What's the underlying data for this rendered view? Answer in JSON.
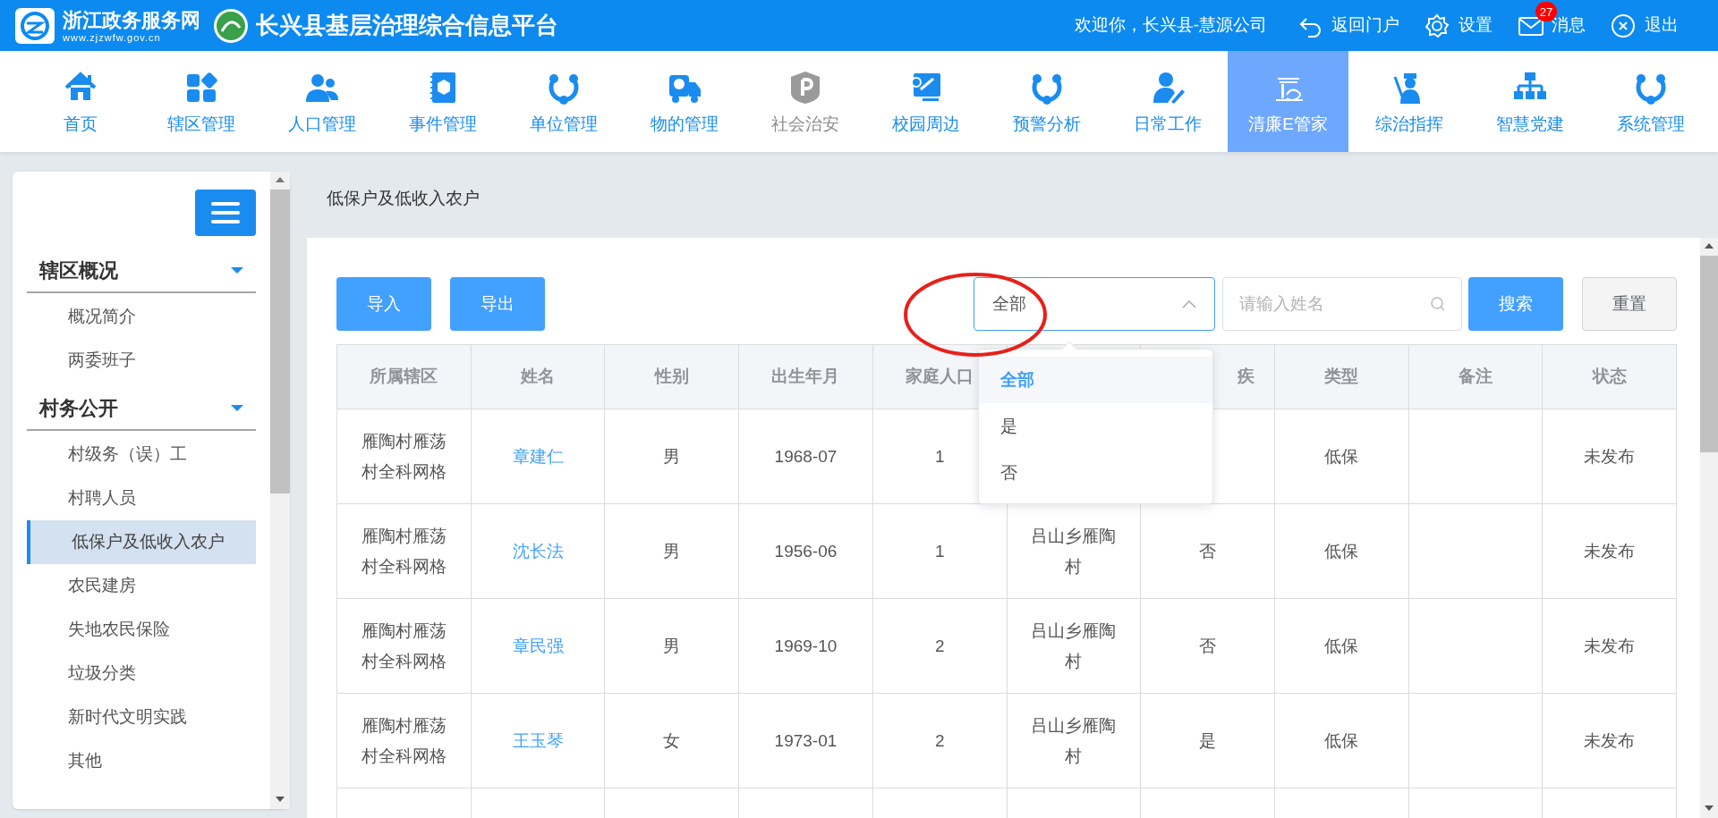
{
  "header": {
    "portal_name": "浙江政务服务网",
    "portal_url": "www.zjzwfw.gov.cn",
    "platform_title": "长兴县基层治理综合信息平台",
    "welcome": "欢迎你，长兴县-慧源公司",
    "links": [
      {
        "kind": "back",
        "label": "返回门户"
      },
      {
        "kind": "settings",
        "label": "设置"
      },
      {
        "kind": "mail",
        "label": "消息",
        "badge": "27"
      },
      {
        "kind": "logout",
        "label": "退出"
      }
    ]
  },
  "nav": [
    {
      "label": "首页",
      "selected": false,
      "disabled": false
    },
    {
      "label": "辖区管理",
      "selected": false,
      "disabled": false
    },
    {
      "label": "人口管理",
      "selected": false,
      "disabled": false
    },
    {
      "label": "事件管理",
      "selected": false,
      "disabled": false
    },
    {
      "label": "单位管理",
      "selected": false,
      "disabled": false
    },
    {
      "label": "物的管理",
      "selected": false,
      "disabled": false
    },
    {
      "label": "社会治安",
      "selected": false,
      "disabled": true
    },
    {
      "label": "校园周边",
      "selected": false,
      "disabled": false
    },
    {
      "label": "预警分析",
      "selected": false,
      "disabled": false
    },
    {
      "label": "日常工作",
      "selected": false,
      "disabled": false
    },
    {
      "label": "清廉E管家",
      "selected": true,
      "disabled": false
    },
    {
      "label": "综治指挥",
      "selected": false,
      "disabled": false
    },
    {
      "label": "智慧党建",
      "selected": false,
      "disabled": false
    },
    {
      "label": "系统管理",
      "selected": false,
      "disabled": false
    }
  ],
  "sidebar": {
    "groups": [
      {
        "title": "辖区概况",
        "expanded": true,
        "items": [
          {
            "label": "概况简介",
            "selected": false
          },
          {
            "label": "两委班子",
            "selected": false
          }
        ]
      },
      {
        "title": "村务公开",
        "expanded": true,
        "items": [
          {
            "label": "村级务（误）工",
            "selected": false
          },
          {
            "label": "村聘人员",
            "selected": false
          },
          {
            "label": "低保户及低收入农户",
            "selected": true
          },
          {
            "label": "农民建房",
            "selected": false
          },
          {
            "label": "失地农民保险",
            "selected": false
          },
          {
            "label": "垃圾分类",
            "selected": false
          },
          {
            "label": "新时代文明实践",
            "selected": false
          },
          {
            "label": "其他",
            "selected": false
          }
        ]
      }
    ]
  },
  "page_title": "低保户及低收入农户",
  "toolbar": {
    "buttons": [
      "导入",
      "导出"
    ],
    "filter": {
      "value": "全部",
      "expanded": true,
      "options": [
        {
          "label": "全部",
          "selected": true
        },
        {
          "label": "是",
          "selected": false
        },
        {
          "label": "否",
          "selected": false
        }
      ]
    },
    "search": {
      "placeholder": "请输入姓名"
    },
    "search_button": "搜索",
    "reset_button": "重置"
  },
  "table": {
    "columns": [
      "所属辖区",
      "姓名",
      "性别",
      "出生年月",
      "家庭人口",
      "",
      "疾",
      "类型",
      "备注",
      "状态"
    ],
    "rows": [
      [
        "雁陶村雁荡村全科网格",
        "章建仁",
        "男",
        "1968-07",
        "1",
        "",
        "",
        "低保",
        "",
        "未发布"
      ],
      [
        "雁陶村雁荡村全科网格",
        "沈长法",
        "男",
        "1956-06",
        "1",
        "吕山乡雁陶村",
        "否",
        "低保",
        "",
        "未发布"
      ],
      [
        "雁陶村雁荡村全科网格",
        "章民强",
        "男",
        "1969-10",
        "2",
        "吕山乡雁陶村",
        "否",
        "低保",
        "",
        "未发布"
      ],
      [
        "雁陶村雁荡村全科网格",
        "王玉琴",
        "女",
        "1973-01",
        "2",
        "吕山乡雁陶村",
        "是",
        "低保",
        "",
        "未发布"
      ],
      [
        "",
        "",
        "",
        "",
        "",
        "",
        "",
        "",
        "",
        ""
      ]
    ]
  }
}
